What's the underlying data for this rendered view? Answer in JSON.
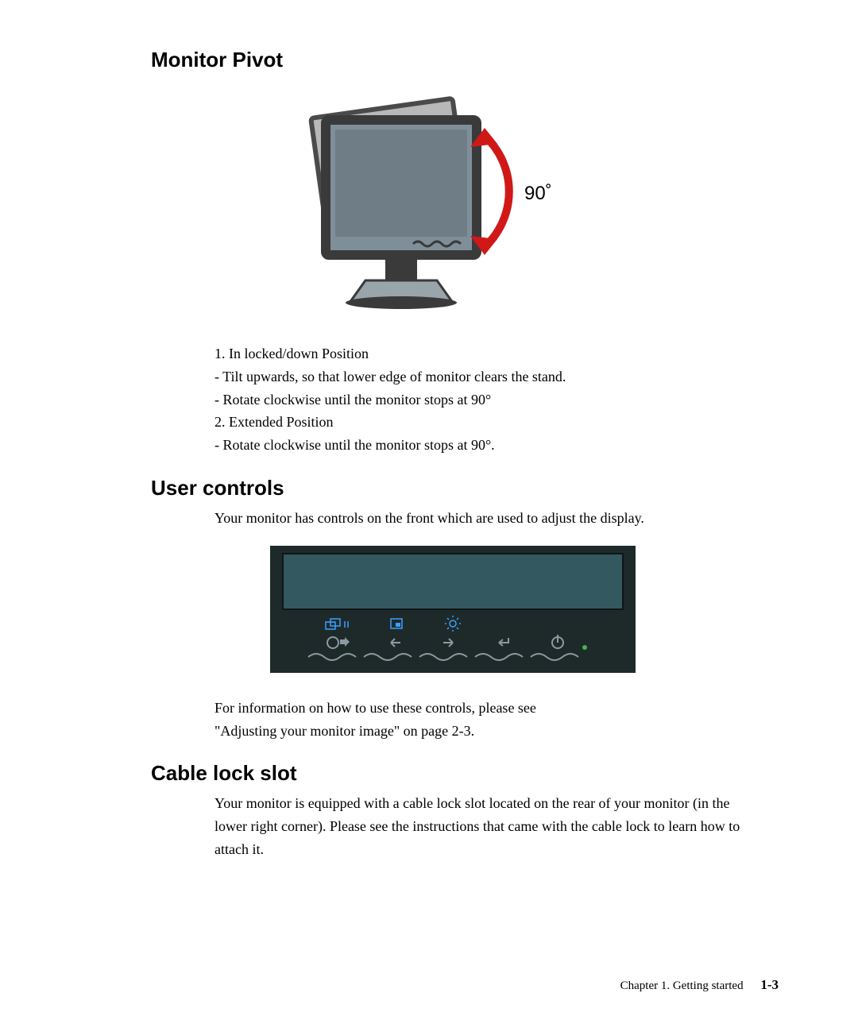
{
  "sections": {
    "pivot": {
      "heading": "Monitor Pivot",
      "angle_label": "90˚",
      "lines": [
        "1. In locked/down Position",
        "- Tilt upwards, so that lower edge of monitor clears the stand.",
        "- Rotate clockwise until the monitor stops at 90°",
        "2. Extended Position",
        "- Rotate clockwise until the monitor stops at 90°."
      ]
    },
    "user_controls": {
      "heading": "User controls",
      "intro": "Your monitor has controls on the front which are used to adjust the display.",
      "ref1": "For information on how to use these controls, please see",
      "ref2": "\"Adjusting your monitor image\" on page 2-3."
    },
    "cable_lock": {
      "heading": "Cable lock slot",
      "body": "Your monitor is equipped with a cable lock slot located on the rear of your monitor (in the lower right corner). Please see the instructions that came with the cable lock to learn how to attach it."
    }
  },
  "footer": {
    "chapter": "Chapter 1. Getting started",
    "page": "1-3"
  }
}
